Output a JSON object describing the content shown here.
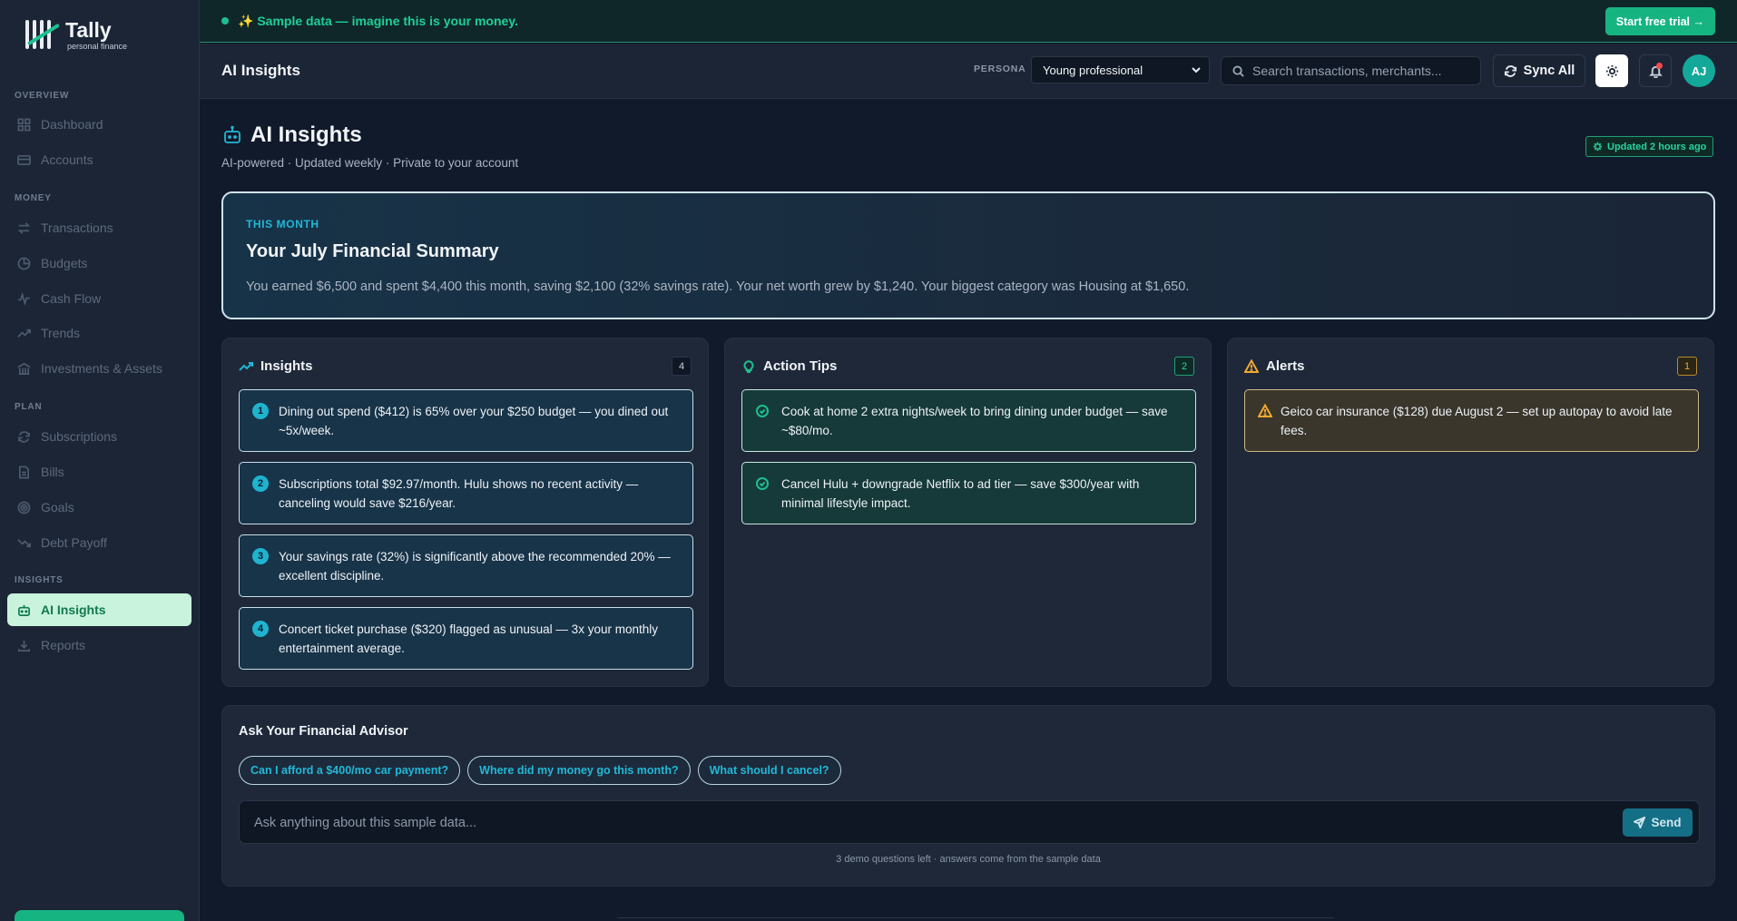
{
  "brand": {
    "name": "Tally",
    "tagline": "personal finance"
  },
  "sidebar": {
    "sections": [
      {
        "label": "OVERVIEW",
        "items": [
          {
            "label": "Dashboard",
            "icon": "grid-icon"
          },
          {
            "label": "Accounts",
            "icon": "card-icon"
          }
        ]
      },
      {
        "label": "MONEY",
        "items": [
          {
            "label": "Transactions",
            "icon": "swap-icon"
          },
          {
            "label": "Budgets",
            "icon": "pie-icon"
          },
          {
            "label": "Cash Flow",
            "icon": "pulse-icon"
          },
          {
            "label": "Trends",
            "icon": "trend-icon"
          },
          {
            "label": "Investments & Assets",
            "icon": "bank-icon"
          }
        ]
      },
      {
        "label": "PLAN",
        "items": [
          {
            "label": "Subscriptions",
            "icon": "refresh-icon"
          },
          {
            "label": "Bills",
            "icon": "document-icon"
          },
          {
            "label": "Goals",
            "icon": "target-icon"
          },
          {
            "label": "Debt Payoff",
            "icon": "trend-down-icon"
          }
        ]
      },
      {
        "label": "INSIGHTS",
        "items": [
          {
            "label": "AI Insights",
            "icon": "robot-icon",
            "active": true
          },
          {
            "label": "Reports",
            "icon": "download-icon"
          }
        ]
      }
    ]
  },
  "banner": {
    "text": "✨ Sample data — imagine this is your money.",
    "cta": "Start free trial →"
  },
  "header": {
    "title": "AI Insights",
    "persona_label": "PERSONA",
    "persona_value": "Young professional",
    "search_placeholder": "Search transactions, merchants...",
    "sync_label": "Sync All",
    "avatar_initials": "AJ"
  },
  "page": {
    "title": "AI Insights",
    "subtitle": "AI-powered · Updated weekly · Private to your account",
    "updated": "Updated 2 hours ago"
  },
  "summary": {
    "label": "THIS MONTH",
    "title": "Your July Financial Summary",
    "text": "You earned $6,500 and spent $4,400 this month, saving $2,100 (32% savings rate). Your net worth grew by $1,240. Your biggest category was Housing at $1,650."
  },
  "columns": {
    "insights": {
      "title": "Insights",
      "count": "4",
      "items": [
        {
          "num": "1",
          "text": "Dining out spend ($412) is 65% over your $250 budget — you dined out ~5x/week."
        },
        {
          "num": "2",
          "text": "Subscriptions total $92.97/month. Hulu shows no recent activity — canceling would save $216/year."
        },
        {
          "num": "3",
          "text": "Your savings rate (32%) is significantly above the recommended 20% — excellent discipline."
        },
        {
          "num": "4",
          "text": "Concert ticket purchase ($320) flagged as unusual — 3x your monthly entertainment average."
        }
      ]
    },
    "tips": {
      "title": "Action Tips",
      "count": "2",
      "items": [
        {
          "text": "Cook at home 2 extra nights/week to bring dining under budget — save ~$80/mo."
        },
        {
          "text": "Cancel Hulu + downgrade Netflix to ad tier — save $300/year with minimal lifestyle impact."
        }
      ]
    },
    "alerts": {
      "title": "Alerts",
      "count": "1",
      "items": [
        {
          "text": "Geico car insurance ($128) due August 2 — set up autopay to avoid late fees."
        }
      ]
    }
  },
  "advisor": {
    "title": "Ask Your Financial Advisor",
    "chips": [
      "Can I afford a $400/mo car payment?",
      "Where did my money go this month?",
      "What should I cancel?"
    ],
    "placeholder": "Ask anything about this sample data...",
    "send_label": "Send",
    "footnote": "3 demo questions left · answers come from the sample data"
  },
  "colors": {
    "accent_green": "#16b481",
    "accent_cyan": "#22b8d6",
    "alert_amber": "#f0a830",
    "background": "#111a2a",
    "surface": "#1e2839"
  }
}
